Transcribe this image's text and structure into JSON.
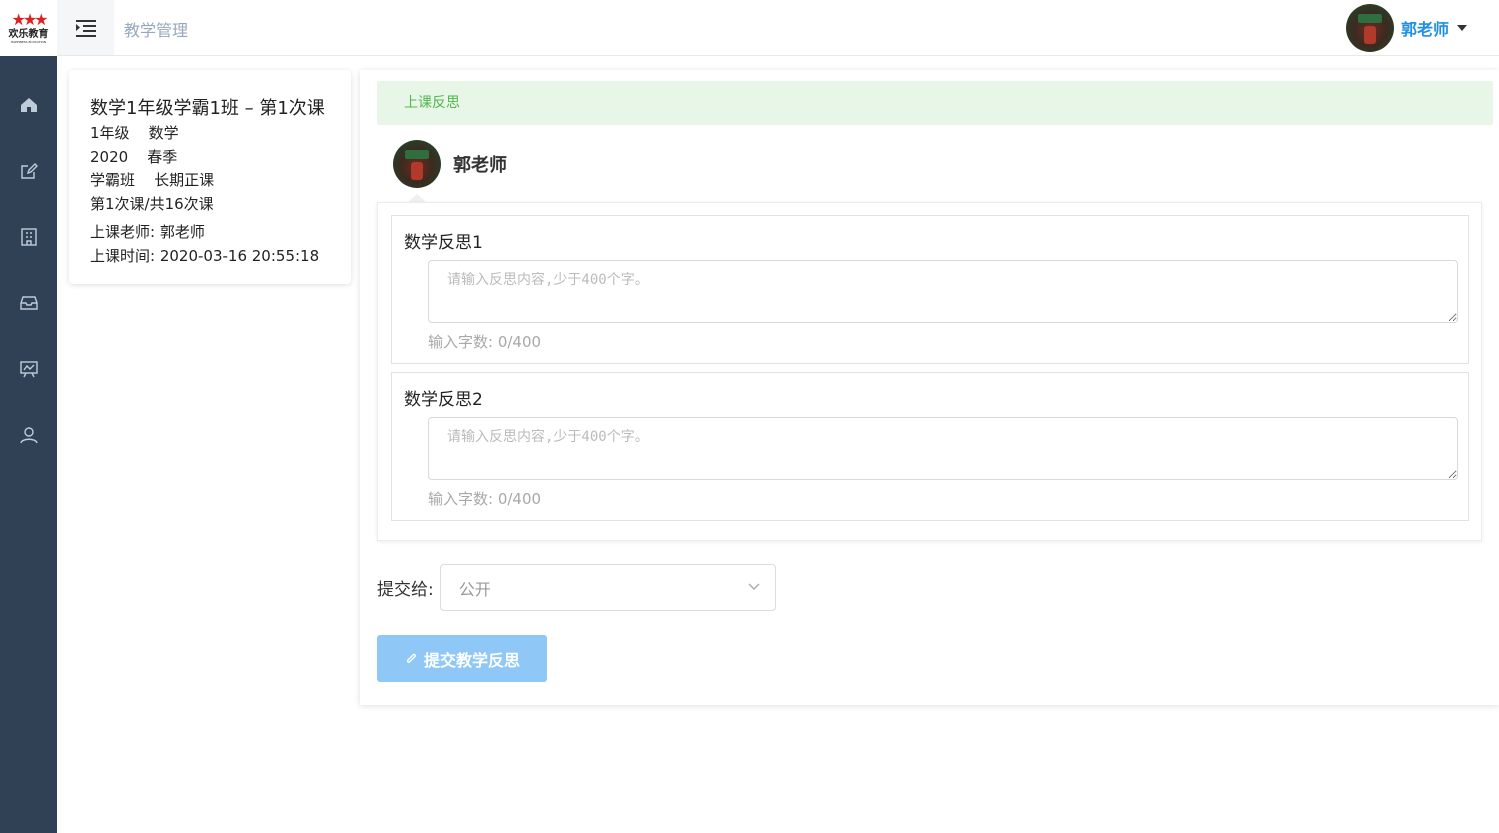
{
  "app": {
    "logo_stars": "★★★",
    "logo_text": "欢乐教育",
    "logo_subtext": "HAPPINESS EDUCATION",
    "breadcrumb": "教学管理"
  },
  "sidebar": {
    "items": [
      {
        "icon": "home-icon"
      },
      {
        "icon": "edit-icon"
      },
      {
        "icon": "building-icon"
      },
      {
        "icon": "inbox-icon"
      },
      {
        "icon": "presentation-icon"
      },
      {
        "icon": "user-icon"
      }
    ]
  },
  "user": {
    "name": "郭老师"
  },
  "course": {
    "title": "数学1年级学霸1班 – 第1次课",
    "grade_subject": "1年级    数学",
    "year_season": "2020    春季",
    "class_type": "学霸班    长期正课",
    "lesson_progress": "第1次课/共16次课",
    "teacher": "上课老师: 郭老师",
    "time": "上课时间: 2020-03-16 20:55:18"
  },
  "reflection": {
    "banner": "上课反思",
    "author_name": "郭老师",
    "questions": [
      {
        "title": "数学反思1",
        "placeholder": "请输入反思内容,少于400个字。",
        "value": "",
        "count": "输入字数: 0/400"
      },
      {
        "title": "数学反思2",
        "placeholder": "请输入反思内容,少于400个字。",
        "value": "",
        "count": "输入字数: 0/400"
      }
    ],
    "submit_to_label": "提交给:",
    "submit_to_value": "公开",
    "submit_button": "提交教学反思"
  },
  "colors": {
    "sidebar_bg": "#304156",
    "accent": "#1e8fe3",
    "banner_bg": "#e8f6e8",
    "banner_text": "#52b84a",
    "button_bg": "#8fc8f7"
  }
}
